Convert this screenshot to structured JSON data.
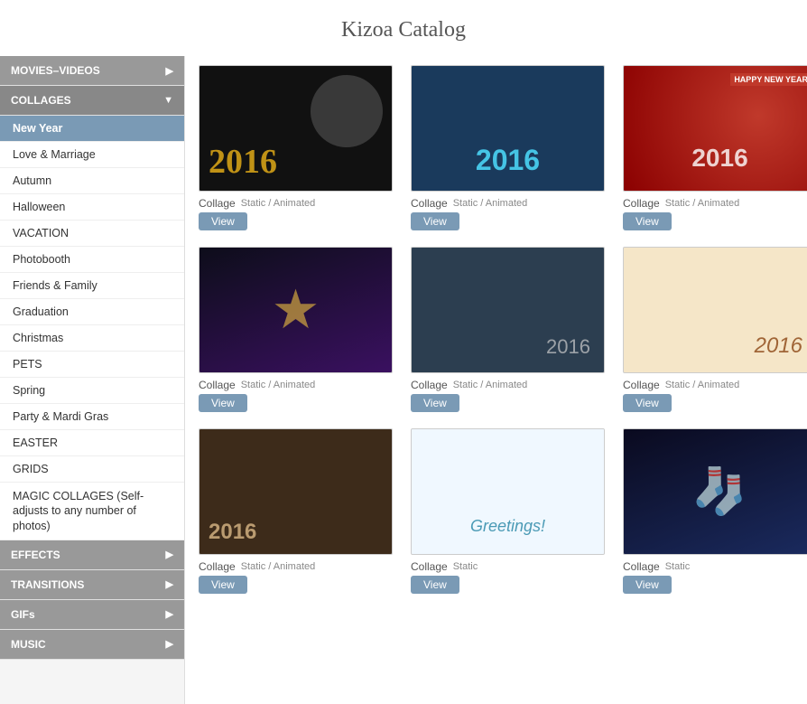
{
  "page": {
    "title": "Kizoa Catalog"
  },
  "sidebar": {
    "sections": [
      {
        "id": "movies-videos",
        "label": "MOVIES–VIDEOS",
        "type": "top-level",
        "arrow": "▶"
      },
      {
        "id": "collages",
        "label": "COLLAGES",
        "type": "top-level",
        "arrow": "▼",
        "active": true
      },
      {
        "id": "new-year",
        "label": "New Year",
        "type": "sub-item",
        "active": true
      },
      {
        "id": "love-marriage",
        "label": "Love & Marriage",
        "type": "sub-item"
      },
      {
        "id": "autumn",
        "label": "Autumn",
        "type": "sub-item"
      },
      {
        "id": "halloween",
        "label": "Halloween",
        "type": "sub-item"
      },
      {
        "id": "vacation",
        "label": "VACATION",
        "type": "sub-item"
      },
      {
        "id": "photobooth",
        "label": "Photobooth",
        "type": "sub-item"
      },
      {
        "id": "friends-family",
        "label": "Friends & Family",
        "type": "sub-item"
      },
      {
        "id": "graduation",
        "label": "Graduation",
        "type": "sub-item"
      },
      {
        "id": "christmas",
        "label": "Christmas",
        "type": "sub-item"
      },
      {
        "id": "pets",
        "label": "PETS",
        "type": "sub-item"
      },
      {
        "id": "spring",
        "label": "Spring",
        "type": "sub-item"
      },
      {
        "id": "party-mardi-gras",
        "label": "Party & Mardi Gras",
        "type": "sub-item"
      },
      {
        "id": "easter",
        "label": "EASTER",
        "type": "sub-item"
      },
      {
        "id": "grids",
        "label": "GRIDS",
        "type": "sub-item"
      },
      {
        "id": "magic-collages",
        "label": "MAGIC COLLAGES (Self-adjusts to any number of photos)",
        "type": "sub-item"
      },
      {
        "id": "effects",
        "label": "EFFECTS",
        "type": "top-level",
        "arrow": "▶"
      },
      {
        "id": "transitions",
        "label": "TRANSITIONS",
        "type": "top-level",
        "arrow": "▶"
      },
      {
        "id": "gifs",
        "label": "GIFs",
        "type": "top-level",
        "arrow": "▶"
      },
      {
        "id": "music",
        "label": "MUSIC",
        "type": "top-level",
        "arrow": "▶"
      }
    ]
  },
  "cards": [
    {
      "id": 1,
      "imgClass": "c1",
      "label": "Collage",
      "type": "Static / Animated",
      "showView": true
    },
    {
      "id": 2,
      "imgClass": "c2",
      "label": "Collage",
      "type": "Static / Animated",
      "showView": true
    },
    {
      "id": 3,
      "imgClass": "c3",
      "label": "Collage",
      "type": "Static / Animated",
      "showView": true
    },
    {
      "id": 4,
      "imgClass": "c4",
      "label": "Collage",
      "type": "Static / Animated",
      "showView": true
    },
    {
      "id": 5,
      "imgClass": "c5",
      "label": "Collage",
      "type": "Static / Animated",
      "showView": true
    },
    {
      "id": 6,
      "imgClass": "c6",
      "label": "Collage",
      "type": "Static / Animated",
      "showView": true
    },
    {
      "id": 7,
      "imgClass": "c7",
      "label": "Collage",
      "type": "Static / Animated",
      "showView": true
    },
    {
      "id": 8,
      "imgClass": "c8",
      "label": "Collage",
      "type": "Static",
      "showView": true
    },
    {
      "id": 9,
      "imgClass": "c9",
      "label": "Collage",
      "type": "Static",
      "showView": true
    }
  ],
  "labels": {
    "view": "View"
  }
}
